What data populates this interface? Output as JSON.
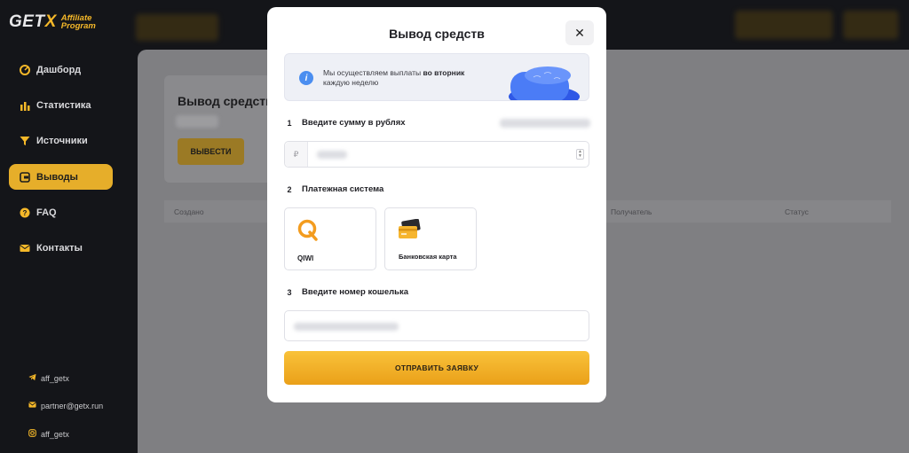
{
  "brand": {
    "logo_main": "GETX",
    "logo_sub_line1": "Affiliate",
    "logo_sub_line2": "Program",
    "accent_color": "#f5b829"
  },
  "sidebar": {
    "items": [
      {
        "label": "Дашборд",
        "icon": "dashboard-icon"
      },
      {
        "label": "Статистика",
        "icon": "bar-chart-icon"
      },
      {
        "label": "Источники",
        "icon": "filter-icon"
      },
      {
        "label": "Выводы",
        "icon": "wallet-icon",
        "active": true
      },
      {
        "label": "FAQ",
        "icon": "help-icon"
      },
      {
        "label": "Контакты",
        "icon": "mail-icon"
      }
    ],
    "contacts": [
      {
        "label": "aff_getx",
        "icon": "telegram-icon"
      },
      {
        "label": "partner@getx.run",
        "icon": "email-icon"
      },
      {
        "label": "aff_getx",
        "icon": "instagram-icon"
      }
    ]
  },
  "background_page": {
    "title": "Вывод средств",
    "withdraw_button": "ВЫВЕСТИ",
    "table_headers": [
      "Создано",
      "Получатель",
      "Статус"
    ]
  },
  "modal": {
    "title": "Вывод средств",
    "close": "✕",
    "info_text_plain": "Мы осуществляем выплаты",
    "info_text_bold": "во вторник",
    "info_text_rest": "каждую неделю",
    "steps": [
      {
        "num": "1",
        "label": "Введите сумму в рублях"
      },
      {
        "num": "2",
        "label": "Платежная система"
      },
      {
        "num": "3",
        "label": "Введите номер кошелька"
      }
    ],
    "currency_symbol": "₽",
    "payment_methods": [
      {
        "label": "QIWI",
        "icon": "qiwi-icon"
      },
      {
        "label": "Банковская карта",
        "icon": "bank-card-icon"
      }
    ],
    "submit_label": "ОТПРАВИТЬ ЗАЯВКУ"
  }
}
